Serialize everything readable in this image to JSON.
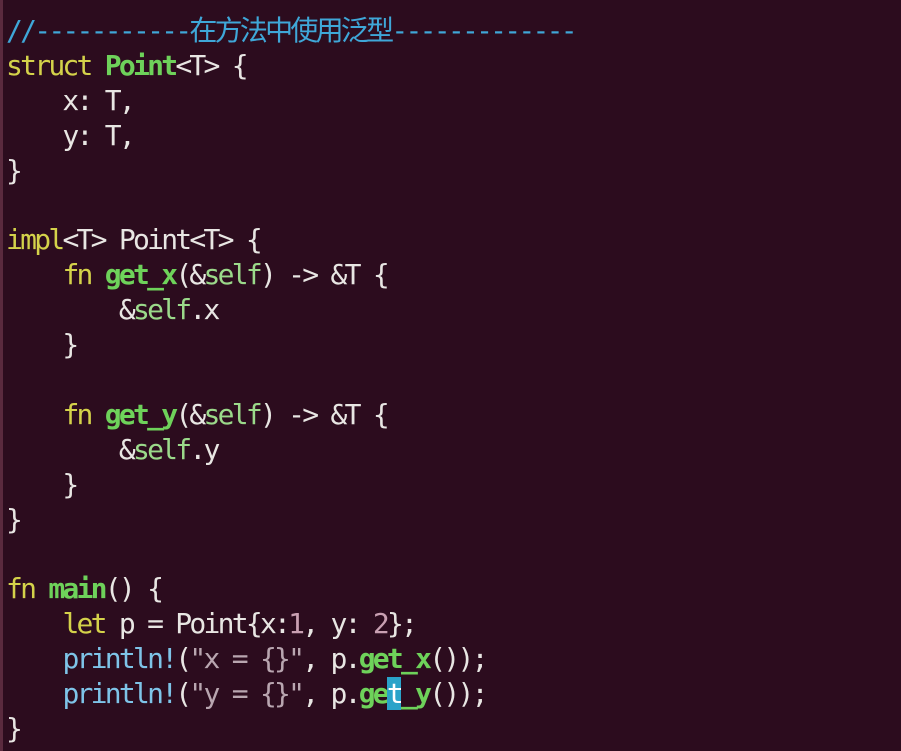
{
  "editor": {
    "colors": {
      "background": "#2c0c1e",
      "comment": "#3fa7d8",
      "keyword": "#d4d24a",
      "type_and_fn": "#6ed25a",
      "macro": "#7ec4e8",
      "string": "#b9a6b0",
      "cursor": "#2aa3c9"
    },
    "cursor": {
      "line": 19,
      "column": 11,
      "char": "t"
    },
    "lines": [
      [
        {
          "t": "//-----------",
          "c": "comment"
        },
        {
          "t": "在方法中使用泛型",
          "c": "comment"
        },
        {
          "t": "-------------",
          "c": "comment"
        }
      ],
      [
        {
          "t": "struct ",
          "c": "keyword"
        },
        {
          "t": "Point",
          "c": "type"
        },
        {
          "t": "<T> {",
          "c": "punct"
        }
      ],
      [
        {
          "t": "    x: T,",
          "c": "plain"
        }
      ],
      [
        {
          "t": "    y: T,",
          "c": "plain"
        }
      ],
      [
        {
          "t": "}",
          "c": "punct"
        }
      ],
      [],
      [
        {
          "t": "impl",
          "c": "keyword"
        },
        {
          "t": "<T> Point<T> {",
          "c": "plain"
        }
      ],
      [
        {
          "t": "    ",
          "c": "plain"
        },
        {
          "t": "fn ",
          "c": "keyword"
        },
        {
          "t": "get_x",
          "c": "fn"
        },
        {
          "t": "(&",
          "c": "punct"
        },
        {
          "t": "self",
          "c": "self"
        },
        {
          "t": ") -> &T {",
          "c": "punct"
        }
      ],
      [
        {
          "t": "        &",
          "c": "plain"
        },
        {
          "t": "self",
          "c": "self"
        },
        {
          "t": ".x",
          "c": "plain"
        }
      ],
      [
        {
          "t": "    }",
          "c": "punct"
        }
      ],
      [],
      [
        {
          "t": "    ",
          "c": "plain"
        },
        {
          "t": "fn ",
          "c": "keyword"
        },
        {
          "t": "get_y",
          "c": "fn"
        },
        {
          "t": "(&",
          "c": "punct"
        },
        {
          "t": "self",
          "c": "self"
        },
        {
          "t": ") -> &T {",
          "c": "punct"
        }
      ],
      [
        {
          "t": "        &",
          "c": "plain"
        },
        {
          "t": "self",
          "c": "self"
        },
        {
          "t": ".y",
          "c": "plain"
        }
      ],
      [
        {
          "t": "    }",
          "c": "punct"
        }
      ],
      [
        {
          "t": "}",
          "c": "punct"
        }
      ],
      [],
      [
        {
          "t": "fn ",
          "c": "keyword"
        },
        {
          "t": "main",
          "c": "fn"
        },
        {
          "t": "() {",
          "c": "punct"
        }
      ],
      [
        {
          "t": "    ",
          "c": "plain"
        },
        {
          "t": "let ",
          "c": "keyword"
        },
        {
          "t": "p = Point{x:",
          "c": "plain"
        },
        {
          "t": "1",
          "c": "number"
        },
        {
          "t": ", y: ",
          "c": "plain"
        },
        {
          "t": "2",
          "c": "number"
        },
        {
          "t": "};",
          "c": "plain"
        }
      ],
      [
        {
          "t": "    ",
          "c": "plain"
        },
        {
          "t": "println!",
          "c": "macro"
        },
        {
          "t": "(",
          "c": "punct"
        },
        {
          "t": "\"x = {}\"",
          "c": "string"
        },
        {
          "t": ", p.",
          "c": "plain"
        },
        {
          "t": "get_x",
          "c": "fn"
        },
        {
          "t": "());",
          "c": "punct"
        }
      ],
      [
        {
          "t": "    ",
          "c": "plain"
        },
        {
          "t": "println!",
          "c": "macro"
        },
        {
          "t": "(",
          "c": "punct"
        },
        {
          "t": "\"y = {}\"",
          "c": "string"
        },
        {
          "t": ", p.",
          "c": "plain"
        },
        {
          "t": "ge",
          "c": "fn"
        },
        {
          "t": "t",
          "c": "cursor"
        },
        {
          "t": "_y",
          "c": "fn"
        },
        {
          "t": "());",
          "c": "punct"
        }
      ],
      [
        {
          "t": "}",
          "c": "punct"
        }
      ]
    ]
  }
}
